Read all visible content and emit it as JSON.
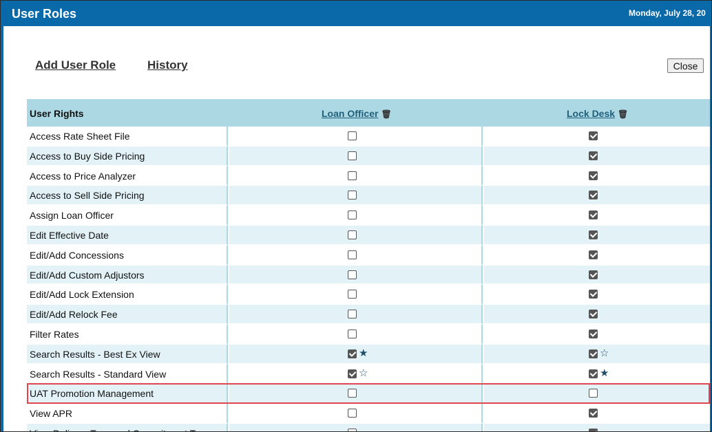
{
  "window": {
    "title": "User Roles",
    "date": "Monday, July 28, 20"
  },
  "nav": {
    "add_user_role": "Add User Role",
    "history": "History",
    "close": "Close"
  },
  "table": {
    "header_rights": "User Rights",
    "columns": [
      {
        "label": "Loan Officer",
        "icon": "trash-icon"
      },
      {
        "label": "Lock Desk",
        "icon": "trash-icon"
      }
    ],
    "rows": [
      {
        "label": "Access Rate Sheet File",
        "loan_officer": false,
        "lock_desk": true
      },
      {
        "label": "Access to Buy Side Pricing",
        "loan_officer": false,
        "lock_desk": true
      },
      {
        "label": "Access to Price Analyzer",
        "loan_officer": false,
        "lock_desk": true
      },
      {
        "label": "Access to Sell Side Pricing",
        "loan_officer": false,
        "lock_desk": true
      },
      {
        "label": "Assign Loan Officer",
        "loan_officer": false,
        "lock_desk": true
      },
      {
        "label": "Edit Effective Date",
        "loan_officer": false,
        "lock_desk": true
      },
      {
        "label": "Edit/Add Concessions",
        "loan_officer": false,
        "lock_desk": true
      },
      {
        "label": "Edit/Add Custom Adjustors",
        "loan_officer": false,
        "lock_desk": true
      },
      {
        "label": "Edit/Add Lock Extension",
        "loan_officer": false,
        "lock_desk": true
      },
      {
        "label": "Edit/Add Relock Fee",
        "loan_officer": false,
        "lock_desk": true
      },
      {
        "label": "Filter Rates",
        "loan_officer": false,
        "lock_desk": true
      },
      {
        "label": "Search Results - Best Ex View",
        "loan_officer": true,
        "lock_desk": true,
        "loan_officer_star": "filled",
        "lock_desk_star": "outline"
      },
      {
        "label": "Search Results - Standard View",
        "loan_officer": true,
        "lock_desk": true,
        "loan_officer_star": "outline",
        "lock_desk_star": "filled"
      },
      {
        "label": "UAT Promotion Management",
        "loan_officer": false,
        "lock_desk": false,
        "highlighted": true
      },
      {
        "label": "View APR",
        "loan_officer": false,
        "lock_desk": true
      },
      {
        "label": "View Delivery Type and Commitment Ty",
        "loan_officer": false,
        "lock_desk": true
      }
    ]
  },
  "colors": {
    "title_bar": "#0a69a8",
    "header_bg": "#acd8e4",
    "row_alt_bg": "#e2f2f7",
    "highlight_border": "#e0474c",
    "column_link": "#1f5f7a"
  },
  "icons": {
    "star_filled": "★",
    "star_outline": "☆",
    "trash": "🗑"
  }
}
